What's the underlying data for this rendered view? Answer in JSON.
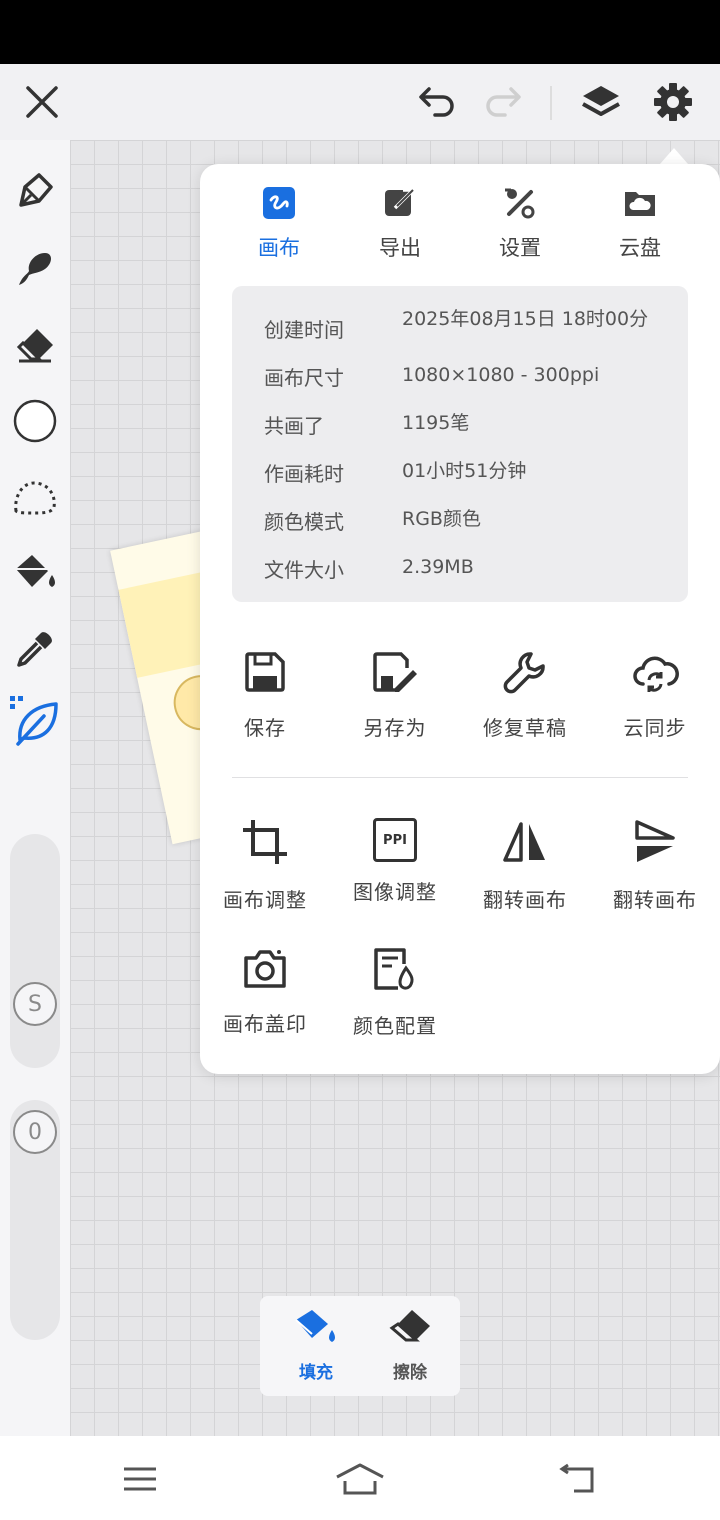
{
  "colors": {
    "accent": "#1a6fe0",
    "icon": "#333333",
    "panel_bg": "#ffffff",
    "info_bg": "#ededef",
    "grid_bg": "#e6e6e8"
  },
  "topbar": {
    "close_icon": "close-icon",
    "undo_icon": "undo-icon",
    "redo_icon": "redo-icon",
    "layers_icon": "layers-icon",
    "settings_icon": "gear-icon"
  },
  "toolbar": {
    "tools": [
      "pen-icon",
      "smudge-brush-icon",
      "eraser-icon",
      "circle-shape-icon",
      "lasso-select-icon",
      "bucket-fill-icon",
      "eyedropper-icon",
      "leaf-brush-icon"
    ],
    "size_slider_label": "S",
    "opacity_slider_label": "0"
  },
  "panel": {
    "tabs": [
      {
        "label": "画布",
        "icon": "canvas-icon",
        "active": true
      },
      {
        "label": "导出",
        "icon": "export-icon",
        "active": false
      },
      {
        "label": "设置",
        "icon": "tools-icon",
        "active": false
      },
      {
        "label": "云盘",
        "icon": "cloud-folder-icon",
        "active": false
      }
    ],
    "info": [
      {
        "label": "创建时间",
        "value": "2025年08月15日 18时00分"
      },
      {
        "label": "画布尺寸",
        "value": "1080×1080 - 300ppi"
      },
      {
        "label": "共画了",
        "value": "1195笔"
      },
      {
        "label": "作画耗时",
        "value": "01小时51分钟"
      },
      {
        "label": "颜色模式",
        "value": "RGB颜色"
      },
      {
        "label": "文件大小",
        "value": "2.39MB"
      }
    ],
    "actions_row1": [
      {
        "label": "保存",
        "icon": "save-icon"
      },
      {
        "label": "另存为",
        "icon": "save-as-icon"
      },
      {
        "label": "修复草稿",
        "icon": "wrench-icon"
      },
      {
        "label": "云同步",
        "icon": "cloud-sync-icon"
      }
    ],
    "actions_row2": [
      {
        "label": "画布调整",
        "icon": "crop-icon"
      },
      {
        "label": "图像调整",
        "icon": "ppi-icon",
        "icon_text": "PPI"
      },
      {
        "label": "翻转画布",
        "icon": "flip-horizontal-icon"
      },
      {
        "label": "翻转画布",
        "icon": "flip-vertical-icon"
      }
    ],
    "actions_row3": [
      {
        "label": "画布盖印",
        "icon": "camera-icon"
      },
      {
        "label": "颜色配置",
        "icon": "color-profile-icon"
      }
    ]
  },
  "fillbar": {
    "fill_label": "填充",
    "erase_label": "擦除"
  },
  "navbar": {
    "menu_icon": "menu-icon",
    "home_icon": "home-icon",
    "back_icon": "back-icon"
  }
}
